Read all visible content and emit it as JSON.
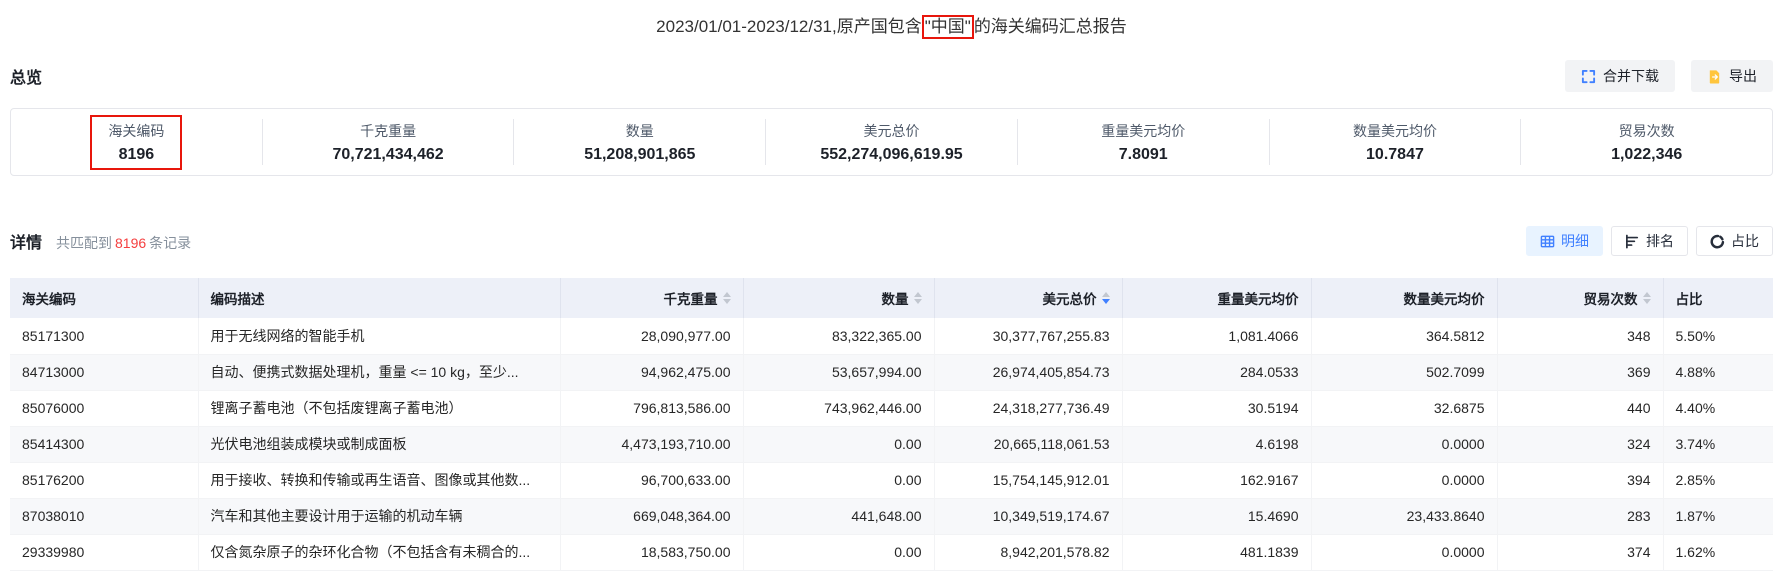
{
  "colors": {
    "accent_blue": "#4080ff",
    "annotation_red": "#e8160c",
    "count_red": "#f53f3f",
    "export_orange": "#ffc53d",
    "header_bg": "#edf0f8",
    "active_tab_bg": "#e8f3ff"
  },
  "title": {
    "prefix": "2023/01/01-2023/12/31,原产国包含",
    "highlight": "\"中国\"",
    "suffix": "的海关编码汇总报告"
  },
  "overview": {
    "heading": "总览",
    "merge_download_label": "合并下载",
    "export_label": "导出",
    "stats": [
      {
        "label": "海关编码",
        "value": "8196",
        "highlighted": true
      },
      {
        "label": "千克重量",
        "value": "70,721,434,462"
      },
      {
        "label": "数量",
        "value": "51,208,901,865"
      },
      {
        "label": "美元总价",
        "value": "552,274,096,619.95"
      },
      {
        "label": "重量美元均价",
        "value": "7.8091"
      },
      {
        "label": "数量美元均价",
        "value": "10.7847"
      },
      {
        "label": "贸易次数",
        "value": "1,022,346"
      }
    ]
  },
  "detail": {
    "heading": "详情",
    "match_prefix": "共匹配到",
    "match_count": "8196",
    "match_suffix": "条记录",
    "view_tabs": [
      {
        "label": "明细",
        "active": true
      },
      {
        "label": "排名",
        "active": false
      },
      {
        "label": "占比",
        "active": false
      }
    ]
  },
  "table": {
    "columns": [
      {
        "key": "code",
        "label": "海关编码",
        "align": "left",
        "sortable": false,
        "sort": ""
      },
      {
        "key": "desc",
        "label": "编码描述",
        "align": "left",
        "sortable": false,
        "sort": ""
      },
      {
        "key": "weight_kg",
        "label": "千克重量",
        "align": "right",
        "sortable": true,
        "sort": ""
      },
      {
        "key": "quantity",
        "label": "数量",
        "align": "right",
        "sortable": true,
        "sort": ""
      },
      {
        "key": "usd_total",
        "label": "美元总价",
        "align": "right",
        "sortable": true,
        "sort": "desc"
      },
      {
        "key": "usd_avg_weight",
        "label": "重量美元均价",
        "align": "right",
        "sortable": false,
        "sort": ""
      },
      {
        "key": "usd_avg_qty",
        "label": "数量美元均价",
        "align": "right",
        "sortable": false,
        "sort": ""
      },
      {
        "key": "trade_count",
        "label": "贸易次数",
        "align": "right",
        "sortable": true,
        "sort": ""
      },
      {
        "key": "ratio",
        "label": "占比",
        "align": "left",
        "sortable": false,
        "sort": ""
      }
    ],
    "rows": [
      [
        "85171300",
        "用于无线网络的智能手机",
        "28,090,977.00",
        "83,322,365.00",
        "30,377,767,255.83",
        "1,081.4066",
        "364.5812",
        "348",
        "5.50%"
      ],
      [
        "84713000",
        "自动、便携式数据处理机，重量 <= 10 kg，至少...",
        "94,962,475.00",
        "53,657,994.00",
        "26,974,405,854.73",
        "284.0533",
        "502.7099",
        "369",
        "4.88%"
      ],
      [
        "85076000",
        "锂离子蓄电池（不包括废锂离子蓄电池）",
        "796,813,586.00",
        "743,962,446.00",
        "24,318,277,736.49",
        "30.5194",
        "32.6875",
        "440",
        "4.40%"
      ],
      [
        "85414300",
        "光伏电池组装成模块或制成面板",
        "4,473,193,710.00",
        "0.00",
        "20,665,118,061.53",
        "4.6198",
        "0.0000",
        "324",
        "3.74%"
      ],
      [
        "85176200",
        "用于接收、转换和传输或再生语音、图像或其他数...",
        "96,700,633.00",
        "0.00",
        "15,754,145,912.01",
        "162.9167",
        "0.0000",
        "394",
        "2.85%"
      ],
      [
        "87038010",
        "汽车和其他主要设计用于运输的机动车辆",
        "669,048,364.00",
        "441,648.00",
        "10,349,519,174.67",
        "15.4690",
        "23,433.8640",
        "283",
        "1.87%"
      ],
      [
        "29339980",
        "仅含氮杂原子的杂环化合物（不包括含有未稠合的...",
        "18,583,750.00",
        "0.00",
        "8,942,201,578.82",
        "481.1839",
        "0.0000",
        "374",
        "1.62%"
      ]
    ]
  }
}
